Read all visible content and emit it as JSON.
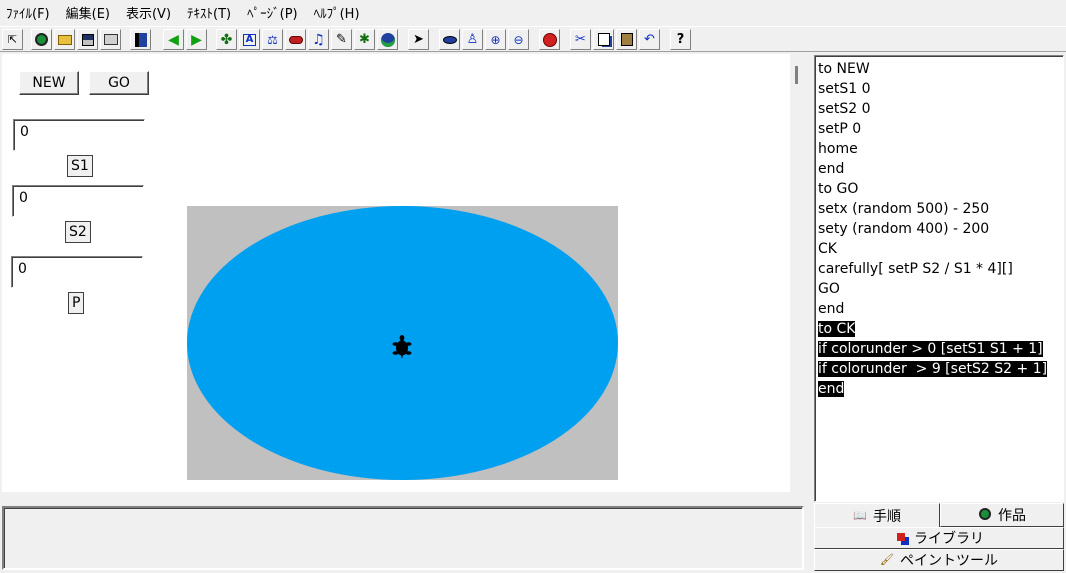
{
  "menubar": {
    "items": [
      "ﾌｧｲﾙ(F)",
      "編集(E)",
      "表示(V)",
      "ﾃｷｽﾄ(T)",
      "ﾍﾟｰｼﾞ(P)",
      "ﾍﾙﾌﾟ(H)"
    ]
  },
  "toolbar": {
    "icons": [
      "select-arrow-icon",
      "globe-icon",
      "open-folder-icon",
      "save-disk-icon",
      "print-icon",
      "page-list-icon",
      "back-arrow-icon",
      "forward-arrow-icon",
      "turtle-icon",
      "text-box-icon",
      "slider-icon",
      "button-icon",
      "music-note-icon",
      "pen-icon",
      "camera-icon",
      "face-icon",
      "pointer-icon",
      "eye-icon",
      "stamp-icon",
      "zoom-in-icon",
      "zoom-out-icon",
      "stop-hand-icon",
      "cut-icon",
      "copy-icon",
      "paste-icon",
      "undo-icon",
      "help-icon"
    ]
  },
  "page": {
    "new_button": "NEW",
    "go_button": "GO",
    "s1_value": "0",
    "s1_label": "S1",
    "s2_value": "0",
    "s2_label": "S2",
    "p_value": "0",
    "p_label": "P"
  },
  "colors": {
    "ellipse": "#00a0f0",
    "scene_bg": "#c0c0c0"
  },
  "code": {
    "lines": [
      "to NEW",
      "setS1 0",
      "setS2 0",
      "setP 0",
      "home",
      "end",
      "to GO",
      "setx (random 500) - 250",
      "sety (random 400) - 200",
      "CK",
      "carefully[ setP S2 / S1 * 4][]",
      "GO",
      "end",
      "to CK",
      "if colorunder > 0 [setS1 S1 + 1]",
      "if colorunder  > 9 [setS2 S2 + 1]",
      "end"
    ],
    "selected_from": 13
  },
  "tabs": {
    "procedures": "手順",
    "project": "作品",
    "library": "ライブラリ",
    "paint_tools": "ペイントツール"
  }
}
